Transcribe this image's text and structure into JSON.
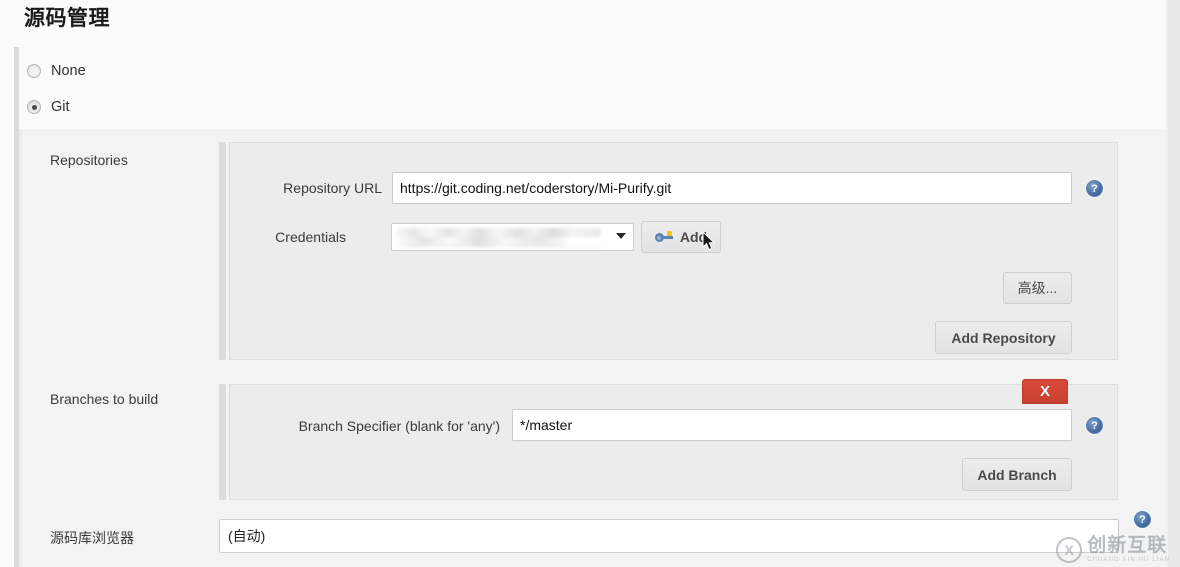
{
  "page": {
    "title": "源码管理"
  },
  "scm": {
    "options": [
      {
        "label": "None",
        "selected": false
      },
      {
        "label": "Git",
        "selected": true
      }
    ]
  },
  "repositories": {
    "row_label": "Repositories",
    "repository_url": {
      "label": "Repository URL",
      "value": "https://git.coding.net/coderstory/Mi-Purify.git"
    },
    "credentials": {
      "label": "Credentials",
      "value": "",
      "redacted": true
    },
    "add_credentials_button": "Add",
    "add_credentials_icon": "key-icon",
    "advanced_button": "高级...",
    "add_repository_button": "Add Repository"
  },
  "branches": {
    "row_label": "Branches to build",
    "branch_specifier": {
      "label": "Branch Specifier (blank for 'any')",
      "value": "*/master"
    },
    "delete_button": "X",
    "add_branch_button": "Add Branch"
  },
  "repository_browser": {
    "row_label": "源码库浏览器",
    "value": "(自动)"
  },
  "help": {
    "glyph": "?",
    "label": "Help"
  },
  "watermark": {
    "mark": "X",
    "cn": "创新互联",
    "en": "CHUANG XIN HU LIAN"
  },
  "colors": {
    "panel_bg": "#ececec",
    "band_bg": "#f3f3f3",
    "delete_red": "#d9483b",
    "help_blue": "#4a72a8",
    "rail_gray": "#dcdcdc"
  }
}
